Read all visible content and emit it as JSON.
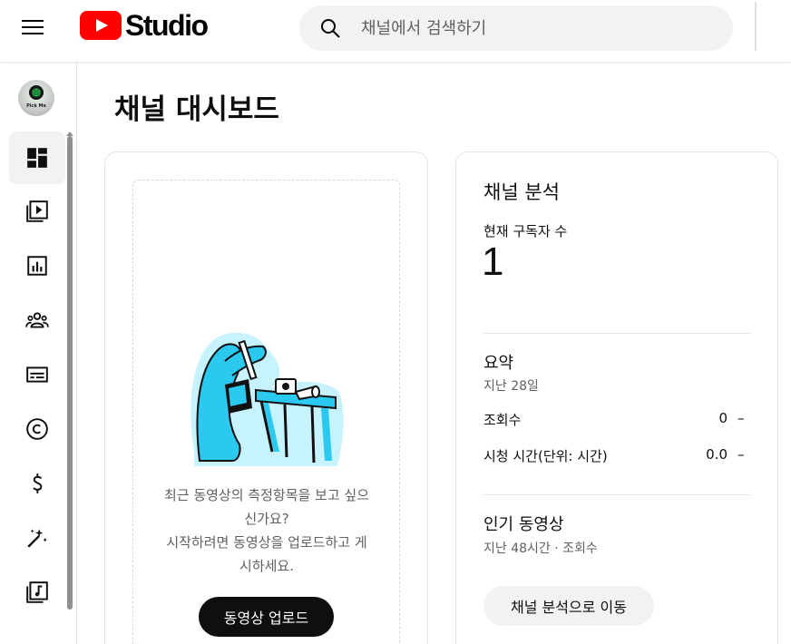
{
  "header": {
    "logo_text": "Studio",
    "search_placeholder": "채널에서 검색하기"
  },
  "sidebar": {
    "avatar_text": "Pick Me",
    "items": [
      {
        "icon": "dashboard-icon",
        "active": true
      },
      {
        "icon": "content-icon"
      },
      {
        "icon": "analytics-icon"
      },
      {
        "icon": "community-icon"
      },
      {
        "icon": "subtitles-icon"
      },
      {
        "icon": "copyright-icon"
      },
      {
        "icon": "monetization-icon"
      },
      {
        "icon": "customization-icon"
      },
      {
        "icon": "audio-library-icon"
      }
    ]
  },
  "main": {
    "page_title": "채널 대시보드",
    "upload_card": {
      "line1": "최근 동영상의 측정항목을 보고 싶으",
      "line2": "신가요?",
      "line3": "시작하려면 동영상을 업로드하고 게",
      "line4": "시하세요.",
      "upload_button": "동영상 업로드"
    },
    "analytics_card": {
      "title": "채널 분석",
      "subscribers_label": "현재 구독자 수",
      "subscribers_value": "1",
      "summary_title": "요약",
      "summary_period": "지난 28일",
      "rows": [
        {
          "label": "조회수",
          "value": "0",
          "trend": "–"
        },
        {
          "label": "시청 시간(단위: 시간)",
          "value": "0.0",
          "trend": "–"
        }
      ],
      "popular_title": "인기 동영상",
      "popular_sub": "지난 48시간 · 조회수",
      "go_button": "채널 분석으로 이동"
    }
  },
  "colors": {
    "brand_red": "#ff0000",
    "illustration_cyan": "#2bc8f0",
    "button_dark": "#0f0f0f"
  }
}
